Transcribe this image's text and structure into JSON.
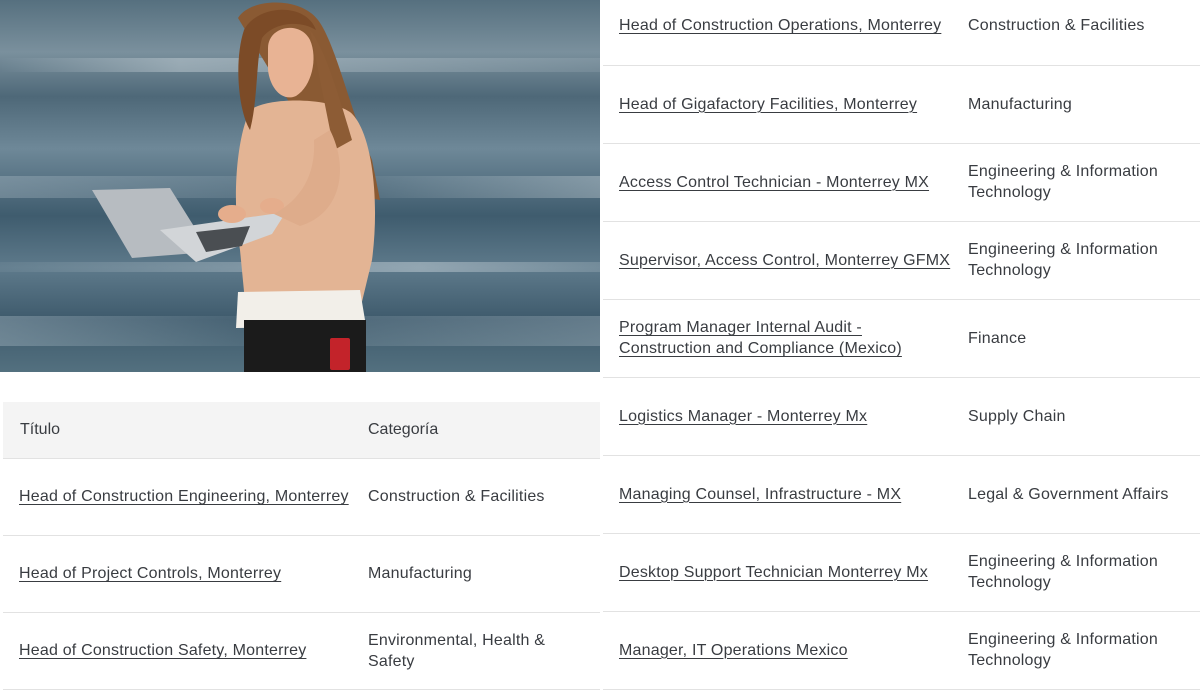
{
  "photo": {
    "alt": "woman-with-laptop-photo"
  },
  "table_headers": {
    "title": "Título",
    "category": "Categoría"
  },
  "left_jobs": [
    {
      "title": "Head of Construction Engineering, Monterrey",
      "category": "Construction & Facilities"
    },
    {
      "title": "Head of Project Controls, Monterrey",
      "category": "Manufacturing"
    },
    {
      "title": "Head of Construction Safety, Monterrey",
      "category": "Environmental, Health & Safety"
    }
  ],
  "right_jobs": [
    {
      "title": "Head of Construction Operations, Monterrey",
      "category": "Construction & Facilities"
    },
    {
      "title": "Head of Gigafactory Facilities, Monterrey",
      "category": "Manufacturing"
    },
    {
      "title": "Access Control Technician - Monterrey MX",
      "category": "Engineering & Information Technology"
    },
    {
      "title": "Supervisor, Access Control, Monterrey GFMX",
      "category": "Engineering & Information Technology"
    },
    {
      "title": "Program Manager Internal Audit - Construction and Compliance (Mexico)",
      "category": "Finance"
    },
    {
      "title": "Logistics Manager - Monterrey Mx",
      "category": "Supply Chain"
    },
    {
      "title": "Managing Counsel, Infrastructure - MX",
      "category": "Legal & Government Affairs"
    },
    {
      "title": "Desktop Support Technician Monterrey Mx",
      "category": "Engineering & Information Technology"
    },
    {
      "title": "Manager, IT Operations Mexico",
      "category": "Engineering & Information Technology"
    }
  ],
  "colors": {
    "text": "#393c41",
    "header_bg": "#f4f4f4",
    "divider": "#e2e2e2"
  }
}
